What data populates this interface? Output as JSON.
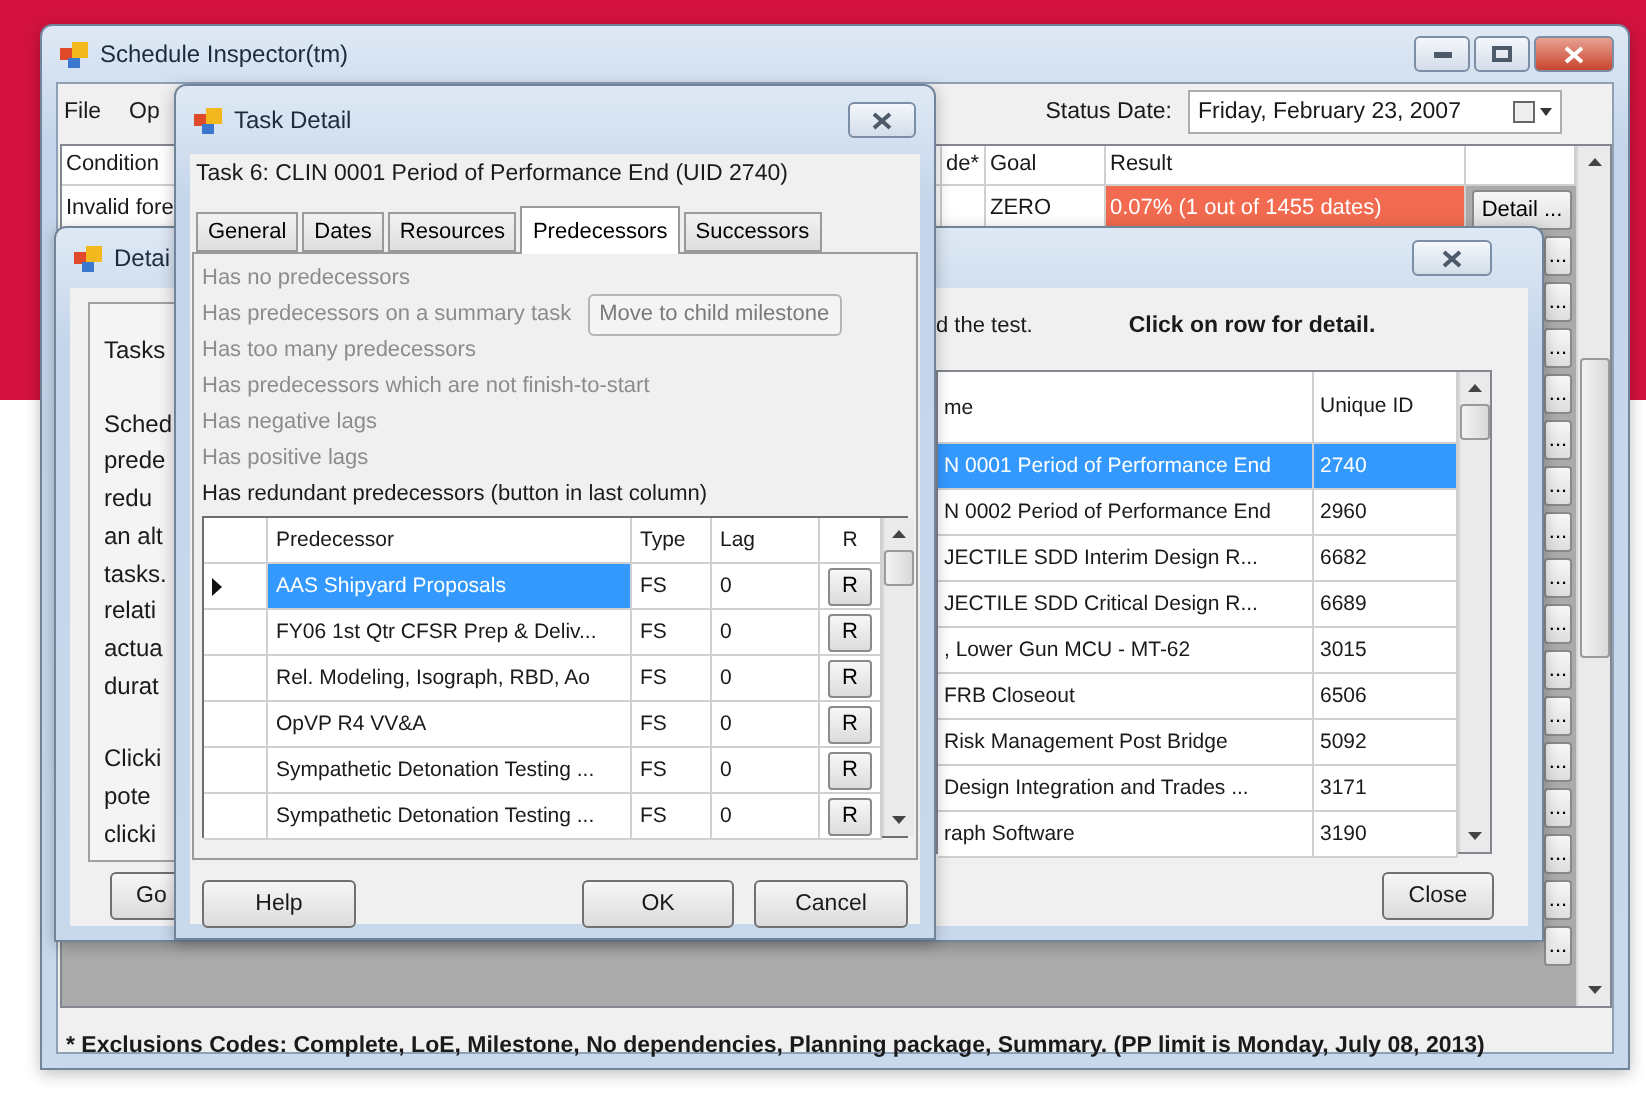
{
  "main_window": {
    "title": "Schedule Inspector(tm)",
    "menu": [
      "File",
      "Op"
    ],
    "status_date": {
      "label": "Status Date:",
      "value": "Friday, February 23, 2007"
    },
    "table": {
      "columns": [
        "Condition",
        "de*",
        "Goal",
        "Result"
      ],
      "rows": [
        {
          "condition": "Invalid fore",
          "goal": "ZERO",
          "result": "0.07% (1 out of 1455 dates)",
          "failed": true,
          "button": "Detail ..."
        }
      ],
      "more_row_buttons": [
        "...",
        "...",
        "...",
        "...",
        "...",
        "...",
        "...",
        "...",
        "...",
        "...",
        "...",
        "...",
        "...",
        "...",
        "...",
        "..."
      ]
    },
    "footnote": "* Exclusions Codes: Complete, LoE, Milestone, No dependencies, Planning package, Summary. (PP limit is Monday, July 08, 2013)"
  },
  "detail_window": {
    "title": "Detai",
    "description": [
      [
        "Tasks"
      ],
      [
        "Sched",
        "prede",
        "redu",
        "an alt",
        "tasks.",
        "relati",
        "actua",
        "durat"
      ],
      [
        "Clicki",
        "pote",
        "clicki"
      ]
    ],
    "hint": "d the test.",
    "instruction": "Click on row for detail.",
    "table": {
      "columns": [
        "me",
        "Unique ID"
      ],
      "rows": [
        {
          "name": "N 0001 Period of Performance End",
          "id": "2740",
          "selected": true
        },
        {
          "name": "N 0002 Period of Performance End",
          "id": "2960",
          "selected": false
        },
        {
          "name": "JECTILE SDD Interim Design R...",
          "id": "6682",
          "selected": false
        },
        {
          "name": "JECTILE SDD Critical Design R...",
          "id": "6689",
          "selected": false
        },
        {
          "name": ", Lower Gun MCU - MT-62",
          "id": "3015",
          "selected": false
        },
        {
          "name": "FRB Closeout",
          "id": "6506",
          "selected": false
        },
        {
          "name": "Risk Management Post Bridge",
          "id": "5092",
          "selected": false
        },
        {
          "name": "Design Integration and Trades ...",
          "id": "3171",
          "selected": false
        },
        {
          "name": "raph Software",
          "id": "3190",
          "selected": false
        }
      ]
    },
    "buttons": [
      "Go",
      "Close"
    ]
  },
  "task_window": {
    "title": "Task Detail",
    "heading": "Task 6: CLIN 0001 Period of Performance End (UID 2740)",
    "tabs": [
      {
        "label": "General",
        "selected": false
      },
      {
        "label": "Dates",
        "selected": false
      },
      {
        "label": "Resources",
        "selected": false
      },
      {
        "label": "Predecessors",
        "selected": true
      },
      {
        "label": "Successors",
        "selected": false
      }
    ],
    "checks": [
      {
        "text": "Has no predecessors",
        "active": false
      },
      {
        "text": "Has predecessors on a summary task",
        "active": false,
        "button": "Move to child milestone"
      },
      {
        "text": "Has too many predecessors",
        "active": false
      },
      {
        "text": "Has predecessors which are not finish-to-start",
        "active": false
      },
      {
        "text": "Has negative lags",
        "active": false
      },
      {
        "text": "Has positive lags",
        "active": false
      },
      {
        "text": "Has redundant predecessors (button in last column)",
        "active": true
      }
    ],
    "table": {
      "columns": [
        "Predecessor",
        "Type",
        "Lag",
        "R"
      ],
      "rows": [
        {
          "name": "AAS Shipyard Proposals",
          "type": "FS",
          "lag": "0",
          "button": "R",
          "selected": true
        },
        {
          "name": "FY06 1st Qtr CFSR Prep & Deliv...",
          "type": "FS",
          "lag": "0",
          "button": "R",
          "selected": false
        },
        {
          "name": "Rel. Modeling, Isograph, RBD, Ao",
          "type": "FS",
          "lag": "0",
          "button": "R",
          "selected": false
        },
        {
          "name": "OpVP R4 VV&A",
          "type": "FS",
          "lag": "0",
          "button": "R",
          "selected": false
        },
        {
          "name": "Sympathetic Detonation Testing ...",
          "type": "FS",
          "lag": "0",
          "button": "R",
          "selected": false
        },
        {
          "name": "Sympathetic Detonation Testing ...",
          "type": "FS",
          "lag": "0",
          "button": "R",
          "selected": false
        }
      ]
    },
    "buttons": [
      "Help",
      "OK",
      "Cancel"
    ]
  }
}
